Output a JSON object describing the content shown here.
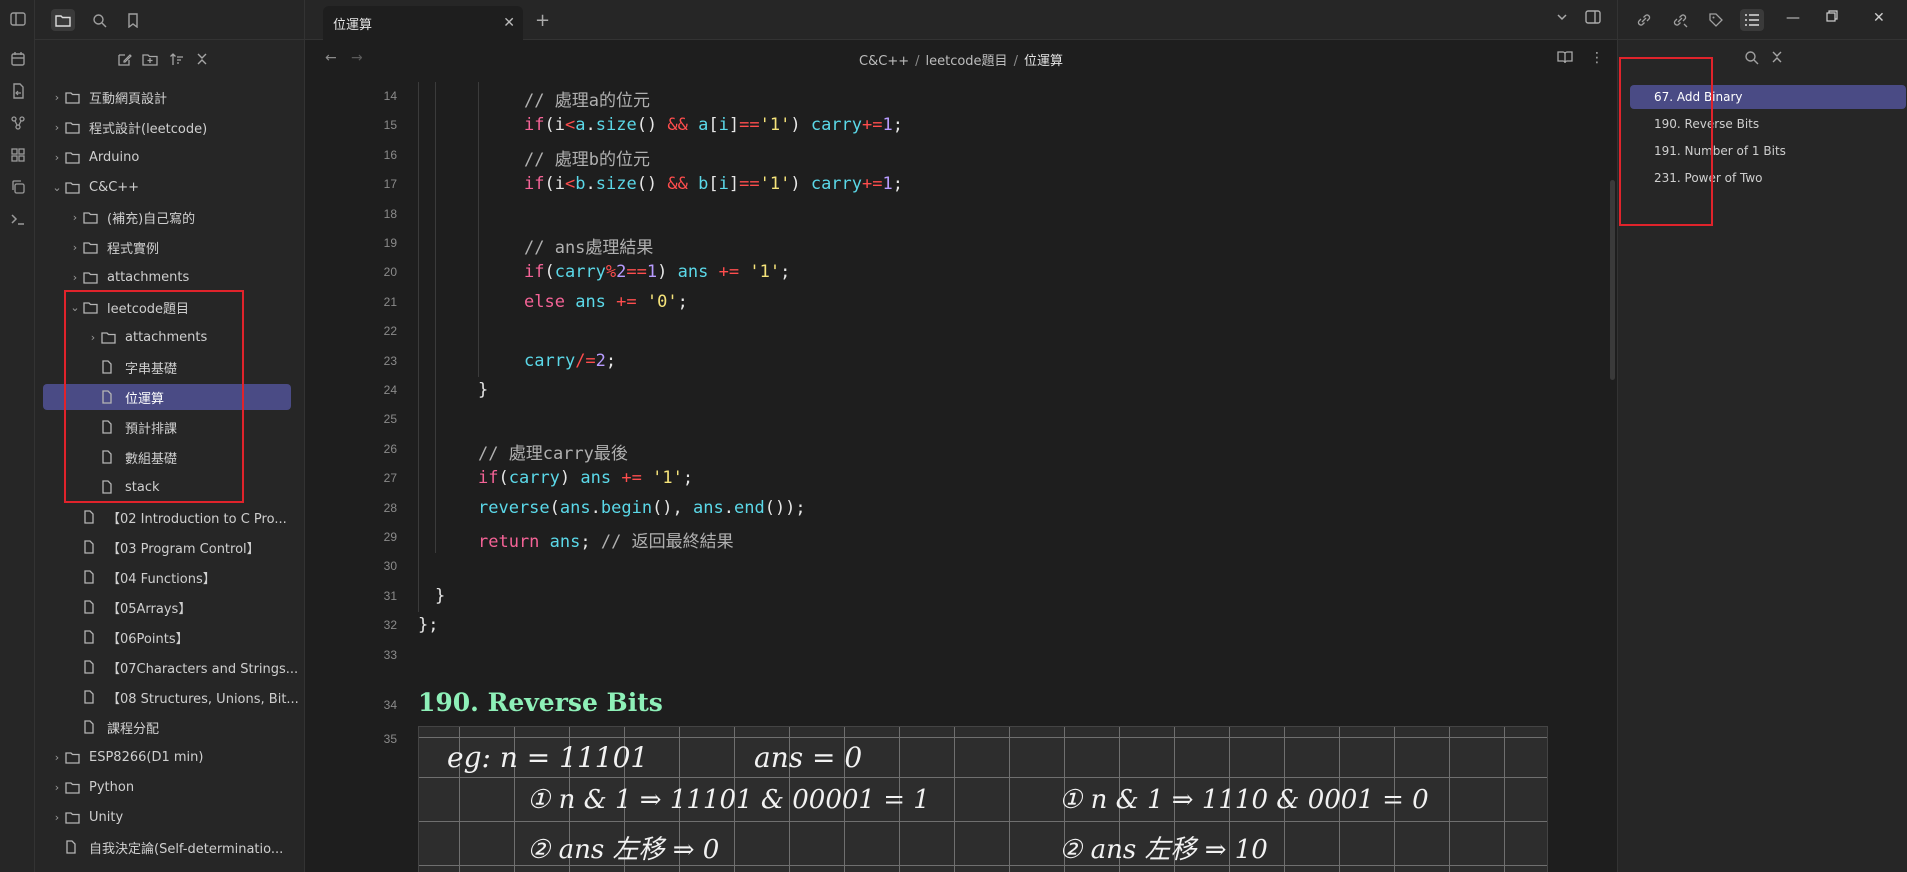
{
  "colors": {
    "accent": "#4a4b85",
    "highlight_box": "#e0232b",
    "heading": "#8ef0b8"
  },
  "ribbon": {
    "icons": [
      "sidebar-toggle-icon",
      "calendar-icon",
      "file-sync-icon",
      "graph-icon",
      "blocks-icon",
      "copy-icon",
      "terminal-icon"
    ]
  },
  "sidebar": {
    "tree": [
      {
        "label": "互動網頁設計",
        "type": "folder",
        "level": 0,
        "expanded": false
      },
      {
        "label": "程式設計(leetcode)",
        "type": "folder",
        "level": 0,
        "expanded": false
      },
      {
        "label": "Arduino",
        "type": "folder",
        "level": 0,
        "expanded": false
      },
      {
        "label": "C&C++",
        "type": "folder",
        "level": 0,
        "expanded": true
      },
      {
        "label": "(補充)自己寫的",
        "type": "folder",
        "level": 1,
        "expanded": false
      },
      {
        "label": "程式實例",
        "type": "folder",
        "level": 1,
        "expanded": false
      },
      {
        "label": "attachments",
        "type": "folder",
        "level": 1,
        "expanded": false
      },
      {
        "label": "leetcode題目",
        "type": "folder",
        "level": 1,
        "expanded": true
      },
      {
        "label": "attachments",
        "type": "folder",
        "level": 2,
        "expanded": false
      },
      {
        "label": "字串基礎",
        "type": "file",
        "level": 2
      },
      {
        "label": "位運算",
        "type": "file",
        "level": 2,
        "selected": true
      },
      {
        "label": "預計排課",
        "type": "file",
        "level": 2
      },
      {
        "label": "數組基礎",
        "type": "file",
        "level": 2
      },
      {
        "label": "stack",
        "type": "file",
        "level": 2
      },
      {
        "label": "【02 Introduction to C Pro...",
        "type": "file",
        "level": 1
      },
      {
        "label": "【03 Program Control】",
        "type": "file",
        "level": 1
      },
      {
        "label": "【04 Functions】",
        "type": "file",
        "level": 1
      },
      {
        "label": "【05Arrays】",
        "type": "file",
        "level": 1
      },
      {
        "label": "【06Points】",
        "type": "file",
        "level": 1
      },
      {
        "label": "【07Characters and Strings...",
        "type": "file",
        "level": 1
      },
      {
        "label": "【08 Structures, Unions, Bit...",
        "type": "file",
        "level": 1
      },
      {
        "label": "課程分配",
        "type": "file",
        "level": 1
      },
      {
        "label": "ESP8266(D1 min)",
        "type": "folder",
        "level": 0,
        "expanded": false
      },
      {
        "label": "Python",
        "type": "folder",
        "level": 0,
        "expanded": false
      },
      {
        "label": "Unity",
        "type": "folder",
        "level": 0,
        "expanded": false
      },
      {
        "label": "自我決定論(Self-determinatio...",
        "type": "file",
        "level": 0
      }
    ]
  },
  "editor": {
    "tab_title": "位運算",
    "breadcrumb": [
      "C&C++",
      "leetcode題目",
      "位運算"
    ],
    "code_lines": [
      {
        "n": "14",
        "indent": 3,
        "tokens": [
          [
            "cm",
            "// 處理a的位元"
          ]
        ]
      },
      {
        "n": "15",
        "indent": 3,
        "tokens": [
          [
            "kw",
            "if"
          ],
          [
            "tx",
            "("
          ],
          [
            "tx",
            "i"
          ],
          [
            "op",
            "<"
          ],
          [
            "vr",
            "a"
          ],
          [
            "tx",
            "."
          ],
          [
            "fn",
            "size"
          ],
          [
            "tx",
            "() "
          ],
          [
            "op",
            "&&"
          ],
          [
            "tx",
            " "
          ],
          [
            "vr",
            "a"
          ],
          [
            "tx",
            "["
          ],
          [
            "vr",
            "i"
          ],
          [
            "tx",
            "]"
          ],
          [
            "op",
            "=="
          ],
          [
            "st",
            "'1'"
          ],
          [
            "tx",
            ") "
          ],
          [
            "vr",
            "carry"
          ],
          [
            "op",
            "+="
          ],
          [
            "nm",
            "1"
          ],
          [
            "tx",
            ";"
          ]
        ]
      },
      {
        "n": "16",
        "indent": 3,
        "tokens": [
          [
            "cm",
            "// 處理b的位元"
          ]
        ]
      },
      {
        "n": "17",
        "indent": 3,
        "tokens": [
          [
            "kw",
            "if"
          ],
          [
            "tx",
            "("
          ],
          [
            "tx",
            "i"
          ],
          [
            "op",
            "<"
          ],
          [
            "vr",
            "b"
          ],
          [
            "tx",
            "."
          ],
          [
            "fn",
            "size"
          ],
          [
            "tx",
            "() "
          ],
          [
            "op",
            "&&"
          ],
          [
            "tx",
            " "
          ],
          [
            "vr",
            "b"
          ],
          [
            "tx",
            "["
          ],
          [
            "vr",
            "i"
          ],
          [
            "tx",
            "]"
          ],
          [
            "op",
            "=="
          ],
          [
            "st",
            "'1'"
          ],
          [
            "tx",
            ") "
          ],
          [
            "vr",
            "carry"
          ],
          [
            "op",
            "+="
          ],
          [
            "nm",
            "1"
          ],
          [
            "tx",
            ";"
          ]
        ]
      },
      {
        "n": "18",
        "indent": 3,
        "tokens": []
      },
      {
        "n": "19",
        "indent": 3,
        "tokens": [
          [
            "cm",
            "// ans處理結果"
          ]
        ]
      },
      {
        "n": "20",
        "indent": 3,
        "tokens": [
          [
            "kw",
            "if"
          ],
          [
            "tx",
            "("
          ],
          [
            "vr",
            "carry"
          ],
          [
            "op",
            "%"
          ],
          [
            "nm",
            "2"
          ],
          [
            "op",
            "=="
          ],
          [
            "nm",
            "1"
          ],
          [
            "tx",
            ") "
          ],
          [
            "vr",
            "ans"
          ],
          [
            "tx",
            " "
          ],
          [
            "op",
            "+="
          ],
          [
            "tx",
            " "
          ],
          [
            "st",
            "'1'"
          ],
          [
            "tx",
            ";"
          ]
        ]
      },
      {
        "n": "21",
        "indent": 3,
        "tokens": [
          [
            "kw",
            "else"
          ],
          [
            "tx",
            " "
          ],
          [
            "vr",
            "ans"
          ],
          [
            "tx",
            " "
          ],
          [
            "op",
            "+="
          ],
          [
            "tx",
            " "
          ],
          [
            "st",
            "'0'"
          ],
          [
            "tx",
            ";"
          ]
        ]
      },
      {
        "n": "22",
        "indent": 3,
        "tokens": []
      },
      {
        "n": "23",
        "indent": 3,
        "tokens": [
          [
            "vr",
            "carry"
          ],
          [
            "op",
            "/="
          ],
          [
            "nm",
            "2"
          ],
          [
            "tx",
            ";"
          ]
        ]
      },
      {
        "n": "24",
        "indent": 2,
        "tokens": [
          [
            "tx",
            "}"
          ]
        ]
      },
      {
        "n": "25",
        "indent": 2,
        "tokens": []
      },
      {
        "n": "26",
        "indent": 2,
        "tokens": [
          [
            "cm",
            "// 處理carry最後"
          ]
        ]
      },
      {
        "n": "27",
        "indent": 2,
        "tokens": [
          [
            "kw",
            "if"
          ],
          [
            "tx",
            "("
          ],
          [
            "vr",
            "carry"
          ],
          [
            "tx",
            ") "
          ],
          [
            "vr",
            "ans"
          ],
          [
            "tx",
            " "
          ],
          [
            "op",
            "+="
          ],
          [
            "tx",
            " "
          ],
          [
            "st",
            "'1'"
          ],
          [
            "tx",
            ";"
          ]
        ]
      },
      {
        "n": "28",
        "indent": 2,
        "tokens": [
          [
            "fn",
            "reverse"
          ],
          [
            "tx",
            "("
          ],
          [
            "vr",
            "ans"
          ],
          [
            "tx",
            "."
          ],
          [
            "fn",
            "begin"
          ],
          [
            "tx",
            "(), "
          ],
          [
            "vr",
            "ans"
          ],
          [
            "tx",
            "."
          ],
          [
            "fn",
            "end"
          ],
          [
            "tx",
            "());"
          ]
        ]
      },
      {
        "n": "29",
        "indent": 2,
        "tokens": [
          [
            "kw",
            "return"
          ],
          [
            "tx",
            " "
          ],
          [
            "vr",
            "ans"
          ],
          [
            "tx",
            "; "
          ],
          [
            "cm",
            "// 返回最終結果"
          ]
        ]
      },
      {
        "n": "30",
        "indent": 1,
        "tokens": []
      },
      {
        "n": "31",
        "indent": 1,
        "tokens": [
          [
            "tx",
            "}"
          ]
        ]
      },
      {
        "n": "32",
        "indent": 0,
        "tokens": [
          [
            "tx",
            "};"
          ]
        ]
      },
      {
        "n": "33",
        "indent": 0,
        "tokens": []
      }
    ],
    "heading_number": "34",
    "heading": "190. Reverse Bits",
    "image_line_number": "35",
    "handwriting": {
      "line1_left": "eg:   n = 11101",
      "line1_right": "ans = 0",
      "line2_left": "① n & 1 ⇒ 11101 & 00001 = 1",
      "line2_right": "① n & 1 ⇒ 1110 & 0001 = 0",
      "line3_left": "② ans 左移 ⇒ 0",
      "line3_right": "② ans 左移 ⇒ 10"
    }
  },
  "outline": {
    "items": [
      {
        "label": "67. Add Binary",
        "selected": true
      },
      {
        "label": "190. Reverse Bits"
      },
      {
        "label": "191. Number of 1 Bits"
      },
      {
        "label": "231. Power of Two"
      }
    ]
  }
}
